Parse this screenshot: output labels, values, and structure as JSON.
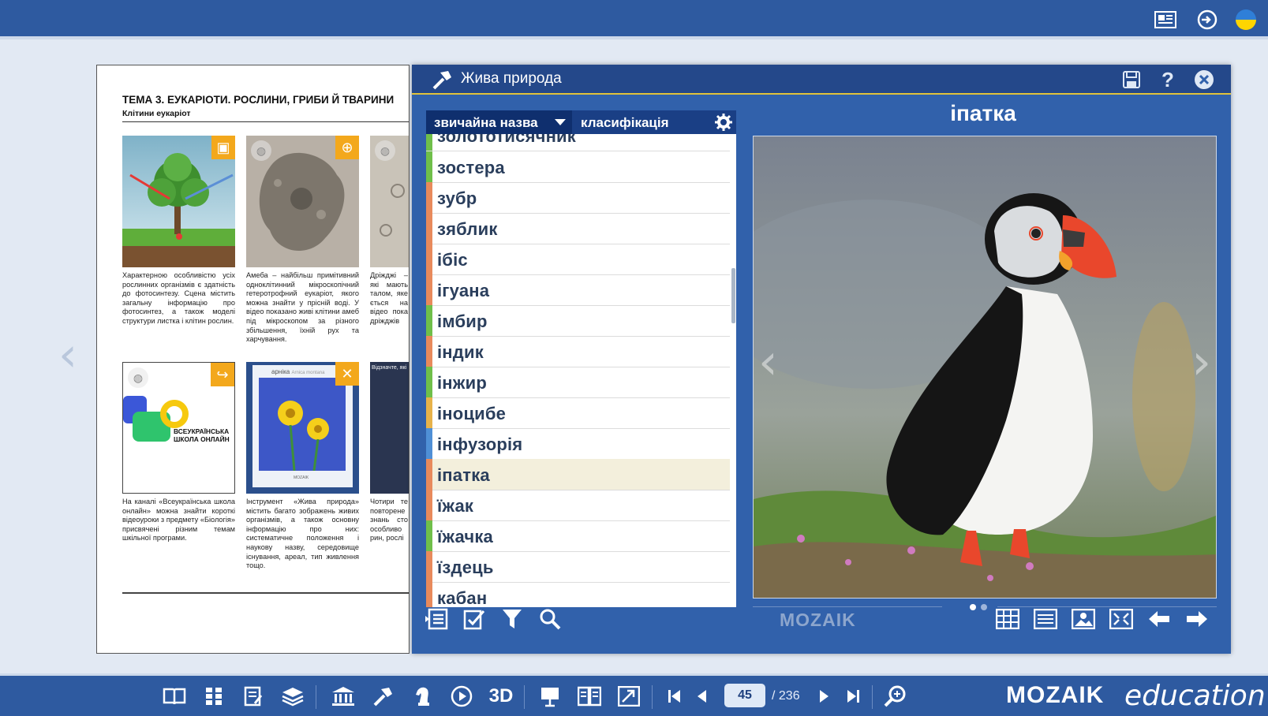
{
  "colors": {
    "accent_blue": "#2e5aa0",
    "modal_blue": "#3161ab",
    "orange_badge": "#f3a81c",
    "selected_row": "#f3efdc"
  },
  "page": {
    "title": "ТЕМА 3. ЕУКАРІОТИ. РОСЛИНИ, ГРИБИ Й ТВАРИНИ",
    "subtitle": "Клітини еукаріот",
    "captions": [
      "Характерною особливістю усіх рослинних організмів є здатність до фотосинтезу. Сцена містить загальну інформацію про фотосинтез, а також моделі структури листка і клітин рослин.",
      "Амеба – найбільш примітивний одноклітинний мікроскопічний гетеротрофний еукаріот, якого можна знайти у прісній воді. У відео показано живі клітини амеб під мікроскопом за різного збільшення, їхній рух та харчування.",
      "Дріжджі – якi мають талом, яке ється на відео пока дріжджів різного з",
      "На каналі «Всеукраїнська школа онлайн» можна знайти короткі відеоуроки з предмету «Біологія» присвячені різним темам шкільної програми.",
      "Інструмент «Жива природа» містить багато зображень живих організмів, а також основну інформацію про них: систематичне положення і наукову назву, середовище існування, ареал, тип живлення тощо.",
      "Чотири те повторене знань сто особливо рин, рослі"
    ],
    "school_logo_text": "ВСЕУКРАЇНСЬКА ШКОЛА ОНЛАЙН",
    "thumb_arnika": "арніка",
    "thumb_arnika_sub": "Arnica montana",
    "thumb_mozaik": "MOZAIK",
    "thumb_quiz": "Відзначте, які"
  },
  "modal": {
    "title": "Жива природа",
    "tab_common": "звичайна назва",
    "tab_class": "класифікація",
    "animal_title": "іпатка",
    "brand_mid": "MOZAIK",
    "list": [
      {
        "name": "золототисячник",
        "color": "#6fbf4a"
      },
      {
        "name": "зостера",
        "color": "#6fbf4a"
      },
      {
        "name": "зубр",
        "color": "#e88a5c"
      },
      {
        "name": "зяблик",
        "color": "#e88a5c"
      },
      {
        "name": "ібіс",
        "color": "#e88a5c"
      },
      {
        "name": "ігуана",
        "color": "#e88a5c"
      },
      {
        "name": "імбир",
        "color": "#6fbf4a"
      },
      {
        "name": "індик",
        "color": "#e88a5c"
      },
      {
        "name": "інжир",
        "color": "#6fbf4a"
      },
      {
        "name": "іноцибе",
        "color": "#e7b24a"
      },
      {
        "name": "інфузорія",
        "color": "#4f8fd6"
      },
      {
        "name": "іпатка",
        "color": "#e88a5c"
      },
      {
        "name": "їжак",
        "color": "#e88a5c"
      },
      {
        "name": "їжачка",
        "color": "#6fbf4a"
      },
      {
        "name": "їздець",
        "color": "#e88a5c"
      },
      {
        "name": "кабан",
        "color": "#e88a5c"
      }
    ],
    "selected_index": 11
  },
  "bottom": {
    "current_page": "45",
    "total_pages": "/ 236",
    "brand": "MOZAIK",
    "brand_edu": "education"
  }
}
